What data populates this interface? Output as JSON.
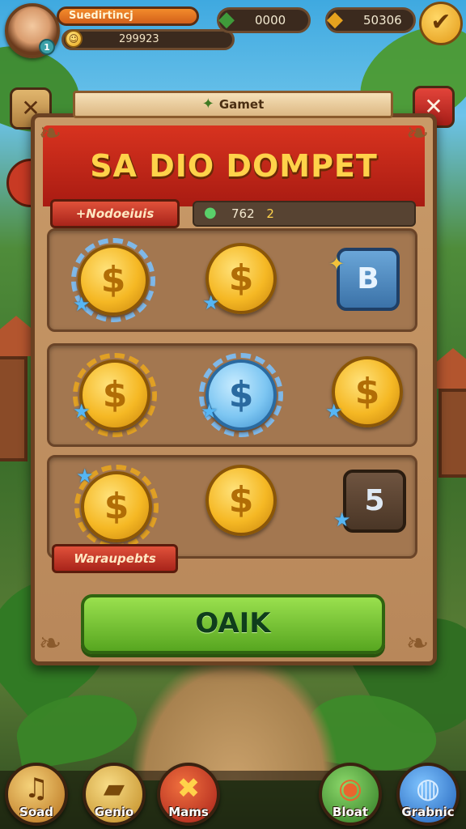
{
  "hud": {
    "player_name": "Suedirtincj",
    "score": "299923",
    "avatar_level": "1",
    "currency_green": "0000",
    "currency_gold": "50306",
    "confirm_icon": "check-icon"
  },
  "side": {
    "left_icon": "close-icon",
    "right_icon": "close-icon"
  },
  "panel": {
    "ribbon_label": "Gamet",
    "title": "SA DIO DOMPET",
    "tag_top": "+Nodoeiuis",
    "info_value": "762",
    "info_suffix": "2",
    "tag_bottom": "Waraupebts"
  },
  "rows": [
    {
      "items": [
        {
          "type": "coin",
          "glyph": "$"
        },
        {
          "type": "coin",
          "glyph": "$"
        },
        {
          "type": "tile",
          "label": "B"
        }
      ]
    },
    {
      "items": [
        {
          "type": "coin",
          "glyph": "$"
        },
        {
          "type": "coin-blue",
          "glyph": "$"
        },
        {
          "type": "coin",
          "glyph": "$"
        }
      ]
    },
    {
      "items": [
        {
          "type": "coin",
          "glyph": "$"
        },
        {
          "type": "coin",
          "glyph": "$"
        },
        {
          "type": "tile",
          "label": "5"
        }
      ]
    }
  ],
  "ok_button": "OAIK",
  "nav": [
    {
      "label": "Soad",
      "icon": "music-note-icon",
      "color": "#e0a838"
    },
    {
      "label": "Genio",
      "icon": "card-icon",
      "color": "#e6b64a"
    },
    {
      "label": "Mams",
      "icon": "map-icon",
      "color": "#d8342a"
    },
    {
      "label": "Bloat",
      "icon": "shell-icon",
      "color": "#4fa04a"
    },
    {
      "label": "Grabnic",
      "icon": "globe-icon",
      "color": "#3a86d8"
    }
  ]
}
